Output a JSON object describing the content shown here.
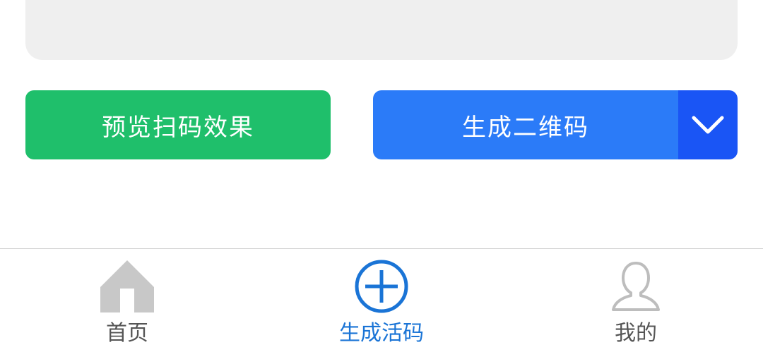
{
  "actions": {
    "preview_label": "预览扫码效果",
    "generate_label": "生成二维码",
    "dropdown_icon": "chevron-down-icon"
  },
  "tabbar": {
    "items": [
      {
        "label": "首页",
        "icon": "home-icon",
        "active": false
      },
      {
        "label": "生成活码",
        "icon": "add-circle-icon",
        "active": true
      },
      {
        "label": "我的",
        "icon": "user-icon",
        "active": false
      }
    ]
  },
  "colors": {
    "preview_button": "#1fbf6b",
    "generate_button": "#2b7bf8",
    "dropdown_button": "#1a55f5",
    "active_tab": "#1a74d6",
    "inactive_icon": "#c8c8c8"
  }
}
